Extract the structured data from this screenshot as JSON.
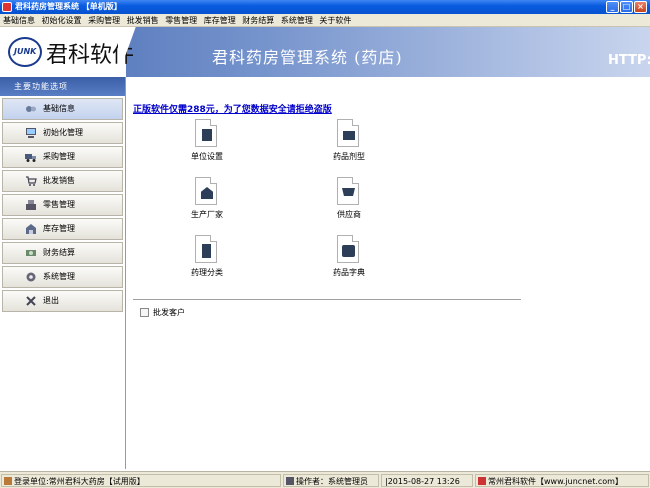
{
  "window": {
    "title": "君科药房管理系统 【单机版】",
    "controls": [
      "_",
      "□",
      "×"
    ]
  },
  "menu": [
    "基础信息",
    "初始化设置",
    "采购管理",
    "批发销售",
    "零售管理",
    "库存管理",
    "财务结算",
    "系统管理",
    "关于软件"
  ],
  "banner": {
    "logo_mark": "JUNK",
    "logo_text": "君科软件",
    "system_title": "君科药房管理系统 (药店)",
    "right_text": "HTTP:"
  },
  "sidebar": {
    "header": "主要功能选项",
    "items": [
      {
        "label": "基础信息",
        "icon": "search-people-icon",
        "active": true
      },
      {
        "label": "初始化管理",
        "icon": "computer-icon"
      },
      {
        "label": "采购管理",
        "icon": "truck-icon"
      },
      {
        "label": "批发销售",
        "icon": "cart-icon"
      },
      {
        "label": "零售管理",
        "icon": "register-icon"
      },
      {
        "label": "库存管理",
        "icon": "warehouse-icon"
      },
      {
        "label": "财务结算",
        "icon": "money-icon"
      },
      {
        "label": "系统管理",
        "icon": "gear-icon"
      },
      {
        "label": "退出",
        "icon": "exit-icon"
      }
    ]
  },
  "main": {
    "notice": "正版软件仅需288元，为了您数据安全请拒绝盗版",
    "modules": [
      {
        "label": "单位设置",
        "icon": "building-icon"
      },
      {
        "label": "药品剂型",
        "icon": "box-icon"
      },
      {
        "label": "生产厂家",
        "icon": "factory-icon"
      },
      {
        "label": "供应商",
        "icon": "cart-icon"
      },
      {
        "label": "药理分类",
        "icon": "cabinet-icon"
      },
      {
        "label": "药品字典",
        "icon": "book-icon"
      }
    ],
    "extra_item": "批发客户"
  },
  "status": {
    "unit": "登录单位:常州君科大药房【试用版】",
    "operator": "操作者：系统管理员",
    "datetime": "|2015-08-27 13:26",
    "company": "常州君科软件【www.juncnet.com】"
  }
}
